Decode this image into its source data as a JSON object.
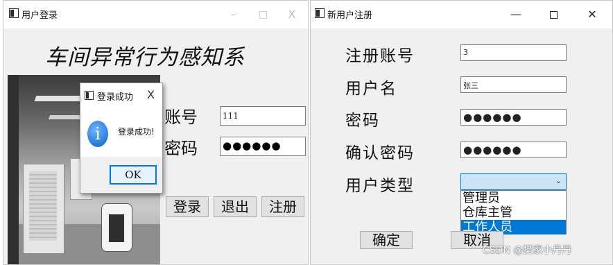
{
  "login_window": {
    "title": "用户登录",
    "controls": {
      "minimize": "–",
      "maximize": "",
      "close": "X"
    },
    "system_title": "车间异常行为感知系统",
    "account_label": "账号",
    "account_value": "111",
    "password_label": "密码",
    "password_value": "●●●●●●",
    "buttons": {
      "login": "登录",
      "exit": "退出",
      "register": "注册"
    }
  },
  "success_dialog": {
    "title": "登录成功",
    "close": "X",
    "icon": "info-icon",
    "icon_glyph": "i",
    "message": "登录成功!",
    "ok_label": "OK"
  },
  "register_window": {
    "title": "新用户注册",
    "controls": {
      "minimize": "—",
      "maximize": "",
      "close": "✕"
    },
    "fields": {
      "account_label": "注册账号",
      "account_value": "3",
      "username_label": "用户名",
      "username_value": "张三",
      "password_label": "密码",
      "password_value": "●●●●●●",
      "confirm_label": "确认密码",
      "confirm_value": "●●●●●●",
      "usertype_label": "用户类型"
    },
    "usertype_selected": "",
    "usertype_options": [
      "管理员",
      "仓库主管",
      "工作人员"
    ],
    "usertype_highlighted": "工作人员",
    "buttons": {
      "confirm": "确定",
      "cancel": "取消"
    }
  },
  "watermark": "CSDN @樊家小丹丹"
}
